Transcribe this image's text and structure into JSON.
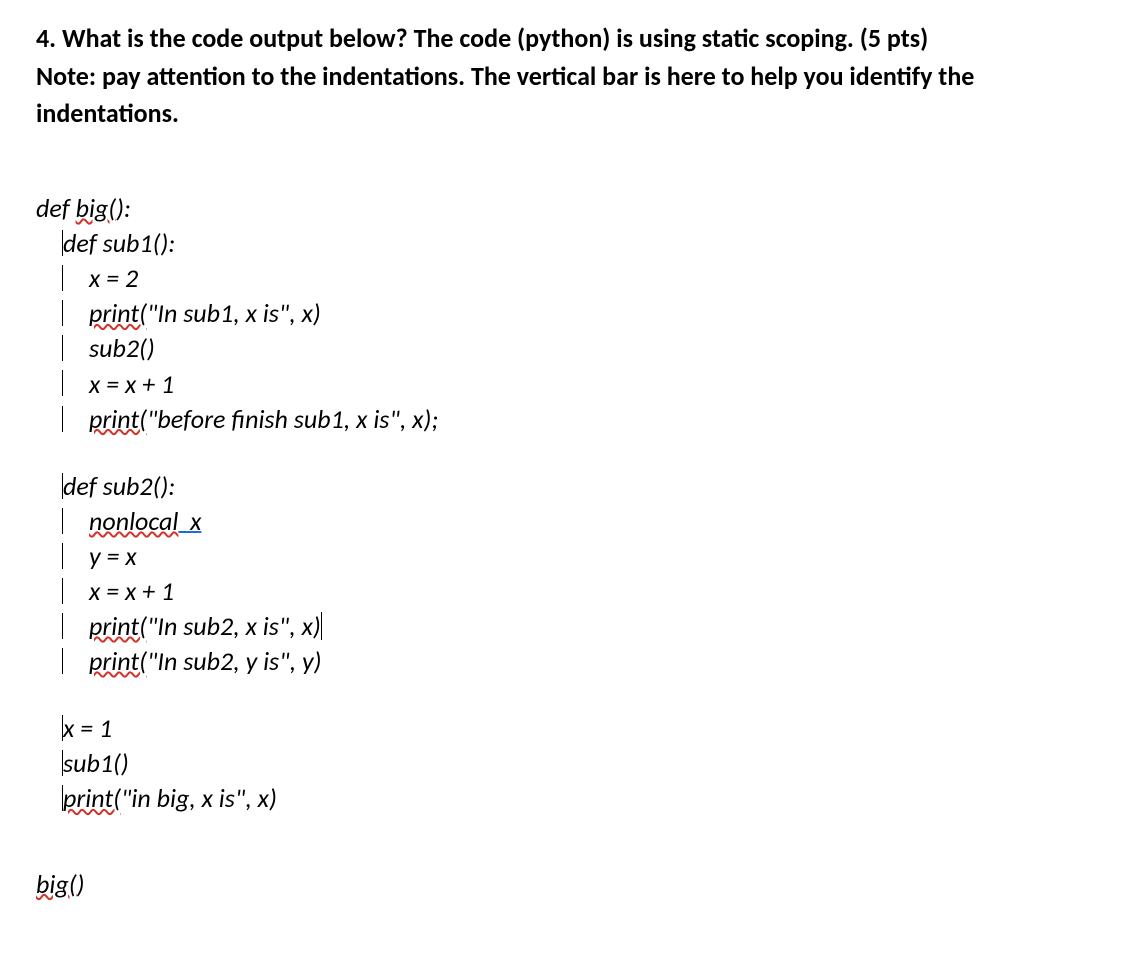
{
  "question": {
    "line1": "4. What is the code output below? The code (python) is using static scoping. (5 pts)",
    "line2": "Note: pay attention to the indentations. The vertical bar is here to help you identify the",
    "line3": "indentations."
  },
  "code": {
    "big_def_pre": "def ",
    "big_def_name": "big(",
    "big_def_post": "):",
    "sub1_def": "def sub1():",
    "sub1_l1": "x = 2",
    "sub1_print1_kw": "print(",
    "sub1_print1_rest": "\"In sub1, x is\", x)",
    "sub1_call": "sub2()",
    "sub1_l4": "x = x + 1",
    "sub1_print2_kw": "print(",
    "sub1_print2_rest": "\"before finish sub1, x is\", x);",
    "sub2_def": "def sub2():",
    "sub2_nonlocal_kw": "nonlocal",
    "sub2_nonlocal_rest": "  x",
    "sub2_l2": "y = x",
    "sub2_l3": "x = x + 1",
    "sub2_print1_kw": "print(",
    "sub2_print1_rest": "\"In sub2, x is\", x)",
    "sub2_print2_kw": "print(",
    "sub2_print2_rest": "\"In sub2, y is\", y)",
    "big_l1": "x = 1",
    "big_l2": "sub1()",
    "big_print_kw": "print(",
    "big_print_rest": "\"in big, x is\", x)",
    "call_big": "big(",
    "call_big_post": ")"
  }
}
